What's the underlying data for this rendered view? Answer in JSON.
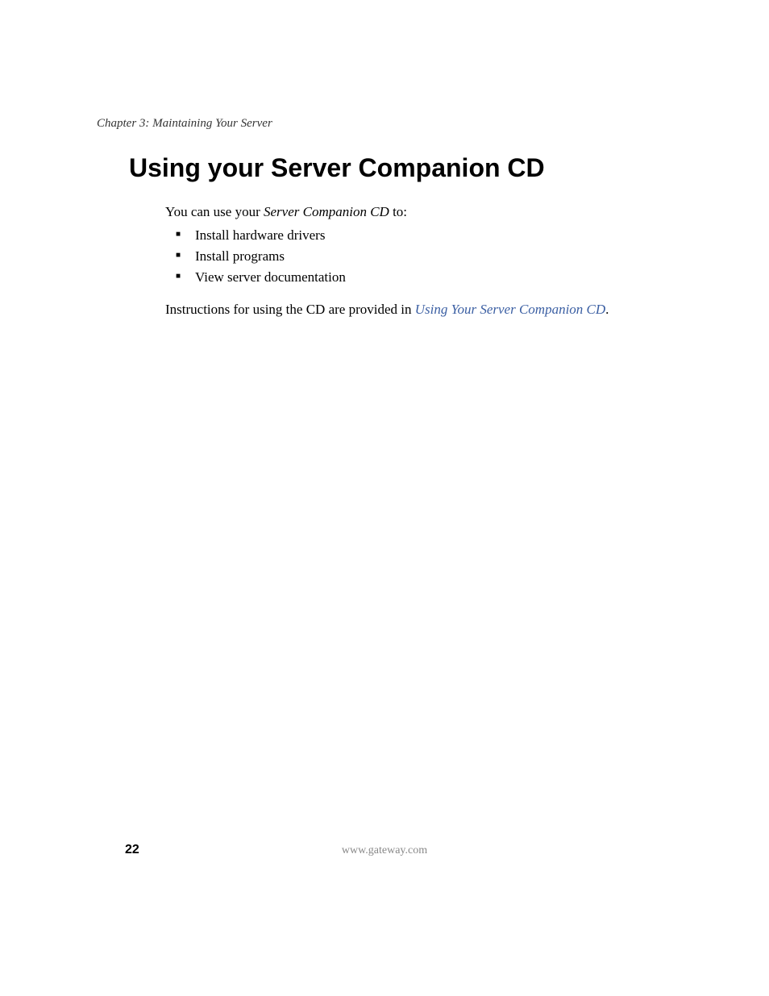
{
  "header": {
    "chapter": "Chapter 3: Maintaining Your Server"
  },
  "title": "Using your Server Companion CD",
  "intro": {
    "prefix": "You can use your ",
    "italic": "Server Companion CD",
    "suffix": " to:"
  },
  "bullets": [
    "Install hardware drivers",
    "Install programs",
    "View server documentation"
  ],
  "instructions": {
    "prefix": "Instructions for using the CD are provided in ",
    "link": "Using Your Server Companion CD",
    "suffix": "."
  },
  "footer": {
    "page_number": "22",
    "url": "www.gateway.com"
  }
}
